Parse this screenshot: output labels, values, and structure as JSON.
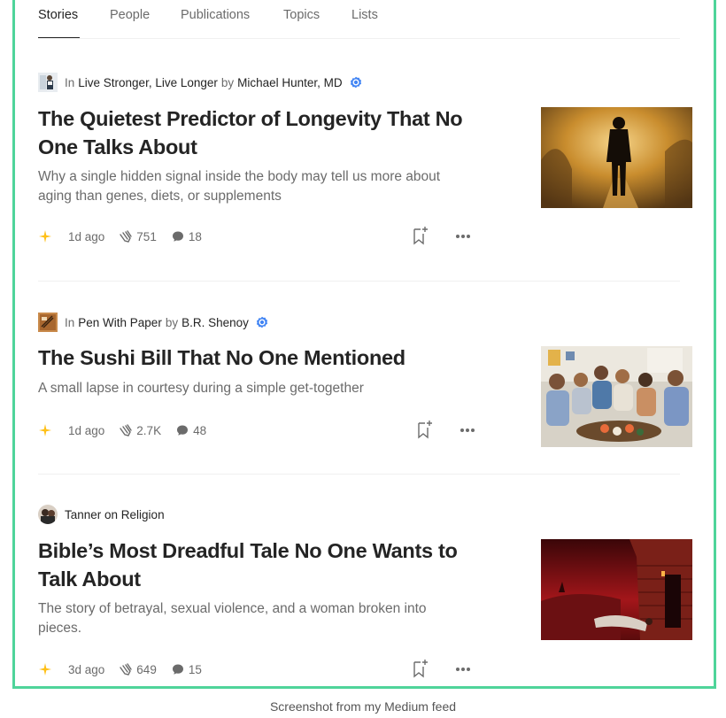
{
  "tabs": [
    {
      "label": "Stories",
      "active": true
    },
    {
      "label": "People",
      "active": false
    },
    {
      "label": "Publications",
      "active": false
    },
    {
      "label": "Topics",
      "active": false
    },
    {
      "label": "Lists",
      "active": false
    }
  ],
  "articles": [
    {
      "in_label": "In",
      "publication": "Live Stronger, Live Longer",
      "by_label": "by",
      "author": "Michael Hunter, MD",
      "verified": true,
      "title": "The Quietest Predictor of Longevity That No One Talks About",
      "subtitle": "Why a single hidden signal inside the body may tell us more about aging than genes, diets, or supplements",
      "age": "1d ago",
      "claps": "751",
      "comments": "18"
    },
    {
      "in_label": "In",
      "publication": "Pen With Paper",
      "by_label": "by",
      "author": "B.R. Shenoy",
      "verified": true,
      "title": "The Sushi Bill That No One Mentioned",
      "subtitle": "A small lapse in courtesy during a simple get-together",
      "age": "1d ago",
      "claps": "2.7K",
      "comments": "48"
    },
    {
      "author_line": "Tanner on Religion",
      "verified": false,
      "title": "Bible’s Most Dreadful Tale No One Wants to Talk About",
      "subtitle": "The story of betrayal, sexual violence, and a woman broken into pieces.",
      "age": "3d ago",
      "claps": "649",
      "comments": "15"
    }
  ],
  "caption": "Screenshot from my Medium feed",
  "colors": {
    "frame_border": "#4fd49a",
    "member_star": "#ffc017",
    "verified_badge": "#4285f4",
    "text_primary": "#242424",
    "text_secondary": "#6b6b6b"
  },
  "icons": {
    "member": "star-icon",
    "claps": "clap-icon",
    "comments": "comment-icon",
    "save": "bookmark-add-icon",
    "more": "more-dots-icon",
    "verified": "verified-badge-icon"
  }
}
